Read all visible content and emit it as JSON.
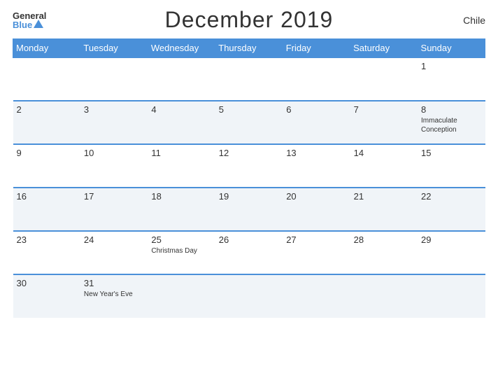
{
  "header": {
    "title": "December 2019",
    "country": "Chile",
    "logo_general": "General",
    "logo_blue": "Blue"
  },
  "weekdays": [
    "Monday",
    "Tuesday",
    "Wednesday",
    "Thursday",
    "Friday",
    "Saturday",
    "Sunday"
  ],
  "weeks": [
    [
      {
        "day": "",
        "event": ""
      },
      {
        "day": "",
        "event": ""
      },
      {
        "day": "",
        "event": ""
      },
      {
        "day": "",
        "event": ""
      },
      {
        "day": "",
        "event": ""
      },
      {
        "day": "",
        "event": ""
      },
      {
        "day": "1",
        "event": ""
      }
    ],
    [
      {
        "day": "2",
        "event": ""
      },
      {
        "day": "3",
        "event": ""
      },
      {
        "day": "4",
        "event": ""
      },
      {
        "day": "5",
        "event": ""
      },
      {
        "day": "6",
        "event": ""
      },
      {
        "day": "7",
        "event": ""
      },
      {
        "day": "8",
        "event": "Immaculate Conception"
      }
    ],
    [
      {
        "day": "9",
        "event": ""
      },
      {
        "day": "10",
        "event": ""
      },
      {
        "day": "11",
        "event": ""
      },
      {
        "day": "12",
        "event": ""
      },
      {
        "day": "13",
        "event": ""
      },
      {
        "day": "14",
        "event": ""
      },
      {
        "day": "15",
        "event": ""
      }
    ],
    [
      {
        "day": "16",
        "event": ""
      },
      {
        "day": "17",
        "event": ""
      },
      {
        "day": "18",
        "event": ""
      },
      {
        "day": "19",
        "event": ""
      },
      {
        "day": "20",
        "event": ""
      },
      {
        "day": "21",
        "event": ""
      },
      {
        "day": "22",
        "event": ""
      }
    ],
    [
      {
        "day": "23",
        "event": ""
      },
      {
        "day": "24",
        "event": ""
      },
      {
        "day": "25",
        "event": "Christmas Day"
      },
      {
        "day": "26",
        "event": ""
      },
      {
        "day": "27",
        "event": ""
      },
      {
        "day": "28",
        "event": ""
      },
      {
        "day": "29",
        "event": ""
      }
    ],
    [
      {
        "day": "30",
        "event": ""
      },
      {
        "day": "31",
        "event": "New Year's Eve"
      },
      {
        "day": "",
        "event": ""
      },
      {
        "day": "",
        "event": ""
      },
      {
        "day": "",
        "event": ""
      },
      {
        "day": "",
        "event": ""
      },
      {
        "day": "",
        "event": ""
      }
    ]
  ]
}
